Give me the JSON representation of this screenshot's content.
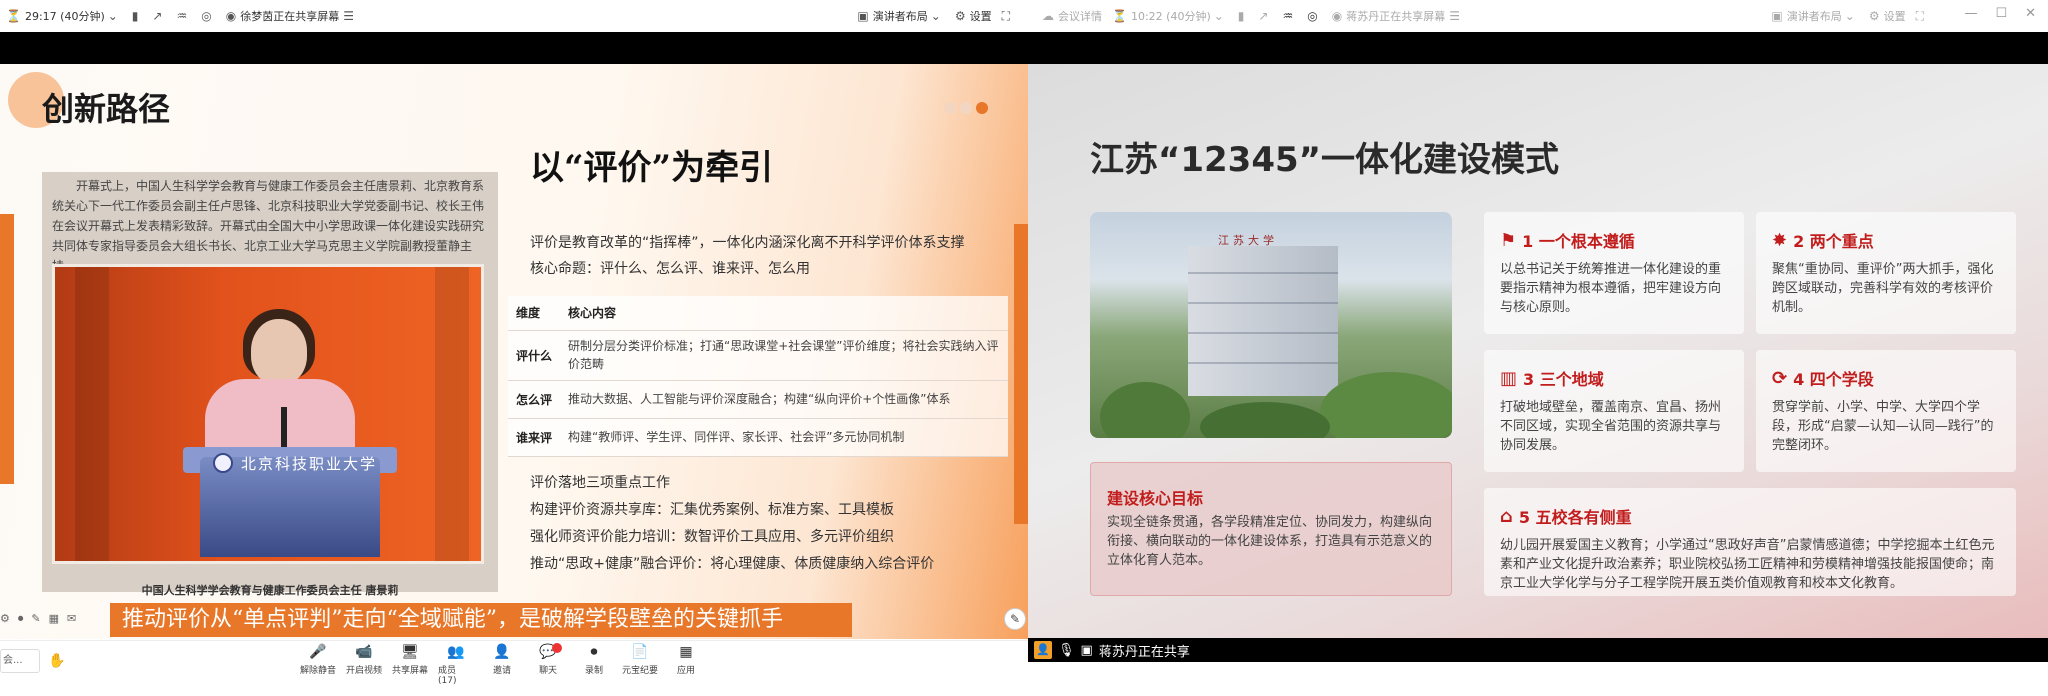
{
  "left": {
    "topbar": {
      "timer": "29:17 (40分钟)",
      "sharing": "徐梦茵正在共享屏幕",
      "layout": "演讲者布局",
      "settings": "设置"
    },
    "slide": {
      "section": "创新路径",
      "photo_text": "开幕式上，中国人生科学学会教育与健康工作委员会主任唐景莉、北京教育系统关心下一代工作委员会副主任卢思锋、北京科技职业大学党委副书记、校长王伟在会议开幕式上发表精彩致辞。开幕式由全国大中小学思政课一体化建设实践研究共同体专家指导委员会大组长书长、北京工业大学马克思主义学院副教授董静主持。",
      "podium_text": "北京科技职业大学",
      "photo_caption": "中国人生科学学会教育与健康工作委员会主任 唐景莉",
      "heading": "以“评价”为牵引",
      "para1": "评价是教育改革的“指挥棒”，一体化内涵深化离不开科学评价体系支撑",
      "para2": "核心命题：评什么、怎么评、谁来评、怎么用",
      "table": {
        "headers": [
          "维度",
          "核心内容"
        ],
        "rows": [
          {
            "dim": "评什么",
            "content": "研制分层分类评价标准；打通“思政课堂+社会课堂”评价维度；将社会实践纳入评价范畴"
          },
          {
            "dim": "怎么评",
            "content": "推动大数据、人工智能与评价深度融合；构建“纵向评价+个性画像”体系"
          },
          {
            "dim": "谁来评",
            "content": "构建“教师评、学生评、同伴评、家长评、社会评”多元协同机制"
          }
        ]
      },
      "points": [
        "评价落地三项重点工作",
        "构建评价资源共享库：汇集优秀案例、标准方案、工具模板",
        "强化师资评价能力培训：数智评价工具应用、多元评价组织",
        "推动“思政+健康”融合评价：将心理健康、体质健康纳入综合评价"
      ]
    },
    "subtitle": "推动评价从“单点评判”走向“全域赋能”，是破解学段壁垒的关键抓手",
    "bottom_left_label": "会...",
    "toolbar": [
      {
        "icon": "mic-icon",
        "glyph": "🎤",
        "label": "解除静音"
      },
      {
        "icon": "video-icon",
        "glyph": "📹",
        "label": "开启视频"
      },
      {
        "icon": "share-screen-icon",
        "glyph": "🖥",
        "label": "共享屏幕"
      },
      {
        "icon": "members-icon",
        "glyph": "👥",
        "label": "成员(17)"
      },
      {
        "icon": "invite-icon",
        "glyph": "👤",
        "label": "邀请"
      },
      {
        "icon": "chat-icon",
        "glyph": "💬",
        "label": "聊天"
      },
      {
        "icon": "record-icon",
        "glyph": "⏺",
        "label": "录制"
      },
      {
        "icon": "minutes-icon",
        "glyph": "📄",
        "label": "元宝纪要"
      },
      {
        "icon": "apps-icon",
        "glyph": "▦",
        "label": "应用"
      }
    ]
  },
  "right": {
    "topbar": {
      "meeting_info": "会议详情",
      "timer": "10:22 (40分钟)",
      "sharing": "蒋苏丹正在共享屏幕",
      "layout": "演讲者布局",
      "settings": "设置"
    },
    "slide": {
      "title": "江苏“12345”一体化建设模式",
      "building_sign": "江苏大学",
      "goal_title": "建设核心目标",
      "goal_text": "实现全链条贯通，各学段精准定位、协同发力，构建纵向衔接、横向联动的一体化建设体系，打造具有示范意义的立体化育人范本。",
      "cards": [
        {
          "icon": "flag-icon",
          "glyph": "⚑",
          "title": "1 一个根本遵循",
          "text": "以总书记关于统筹推进一体化建设的重要指示精神为根本遵循，把牢建设方向与核心原则。"
        },
        {
          "icon": "star-icon",
          "glyph": "✸",
          "title": "2 两个重点",
          "text": "聚焦“重协同、重评价”两大抓手，强化跨区域联动，完善科学有效的考核评价机制。"
        },
        {
          "icon": "map-icon",
          "glyph": "▥",
          "title": "3 三个地域",
          "text": "打破地域壁垒，覆盖南京、宜昌、扬州不同区域，实现全省范围的资源共享与协同发展。"
        },
        {
          "icon": "route-icon",
          "glyph": "⟳",
          "title": "4 四个学段",
          "text": "贯穿学前、小学、中学、大学四个学段，形成“启蒙—认知—认同—践行”的完整闭环。"
        },
        {
          "icon": "school-icon",
          "glyph": "⌂",
          "title": "5 五校各有侧重",
          "text": "幼儿园开展爱国主义教育；小学通过“思政好声音”启蒙情感道德；中学挖掘本土红色元素和产业文化提升政治素养；职业院校弘扬工匠精神和劳模精神增强技能报国使命；南京工业大学化学与分子工程学院开展五类价值观教育和校本文化教育。"
        }
      ]
    },
    "status": "蒋苏丹正在共享"
  }
}
